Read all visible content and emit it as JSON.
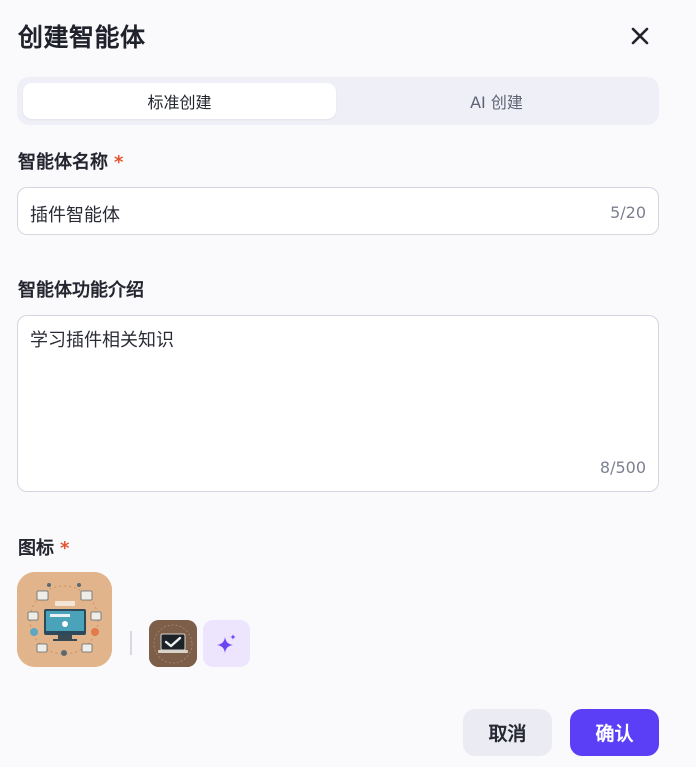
{
  "dialog": {
    "title": "创建智能体",
    "close_icon": "close-icon"
  },
  "tabs": [
    {
      "label": "标准创建",
      "active": true
    },
    {
      "label": "AI 创建",
      "active": false
    }
  ],
  "name_field": {
    "label": "智能体名称",
    "required_mark": "*",
    "value": "插件智能体",
    "count": "5/20"
  },
  "desc_field": {
    "label": "智能体功能介绍",
    "value": "学习插件相关知识",
    "count": "8/500"
  },
  "icon_field": {
    "label": "图标",
    "required_mark": "*",
    "selected_icon": "plugin-dashboard-illustration",
    "alt_icon": "laptop-check-illustration",
    "generate_icon": "sparkle-icon"
  },
  "footer": {
    "cancel_label": "取消",
    "confirm_label": "确认"
  },
  "colors": {
    "accent": "#5a3ff6",
    "required": "#e5532f"
  }
}
